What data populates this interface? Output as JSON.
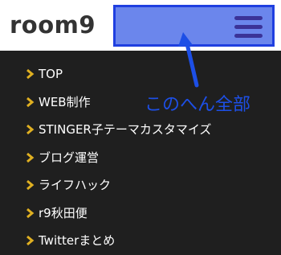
{
  "header": {
    "logo": "room9",
    "menu_button_label": "menu"
  },
  "nav": {
    "items": [
      {
        "label": "TOP"
      },
      {
        "label": "WEB制作"
      },
      {
        "label": "STINGER子テーマカスタマイズ"
      },
      {
        "label": "ブログ運営"
      },
      {
        "label": "ライフハック"
      },
      {
        "label": "r9秋田便"
      },
      {
        "label": "Twitterまとめ"
      }
    ]
  },
  "annotation": {
    "text": "このへん全部"
  },
  "colors": {
    "header_bg": "#ffffff",
    "nav_bg": "#1f1f1f",
    "menu_highlight": "#6b86ec",
    "menu_border": "#1f3fe0",
    "hamburger": "#3b3398",
    "chevron": "#e0b021",
    "annotation": "#1d4fe6"
  }
}
